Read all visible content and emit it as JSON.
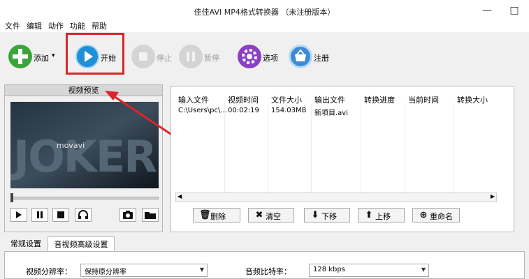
{
  "window": {
    "title": "佳佳AVI MP4格式转换器 （未注册版本）",
    "minimize": "—",
    "restore": "□",
    "close": "✕"
  },
  "menu": [
    "文件",
    "编辑",
    "动作",
    "功能",
    "帮助"
  ],
  "toolbar": {
    "add": "添加",
    "add_caret": "▾",
    "start": "开始",
    "stop": "停止",
    "pause": "暂停",
    "options": "选项",
    "register": "注册"
  },
  "preview": {
    "title": "视频预览",
    "movie_text": "JOKER",
    "watermark": "movavi",
    "seek_position": 0.0
  },
  "file_list": {
    "columns": [
      "输入文件",
      "视频时间",
      "文件大小",
      "输出文件",
      "转换进度",
      "当前时间",
      "转换大小"
    ],
    "rows": [
      {
        "input": "C:\\Users\\pc\\...",
        "duration": "00:02:19",
        "size": "154.03MB",
        "output": "新项目.avi",
        "progress": "",
        "current": "",
        "converted": ""
      }
    ]
  },
  "actions": {
    "delete": "删除",
    "clear": "清空",
    "down": "下移",
    "up": "上移",
    "rename": "重命名"
  },
  "settings": {
    "tabs": [
      "常规设置",
      "音视频高级设置"
    ],
    "active_tab": 1,
    "video_resolution_label": "视频分辨率：",
    "video_resolution_value": "保持原分辨率",
    "audio_bitrate_label": "音频比特率：",
    "audio_bitrate_value": "128 kbps"
  },
  "colors": {
    "highlight": "#d9262a",
    "add_green": "#3ba43b",
    "start_blue": "#1e90d6",
    "options_purple": "#8a3fc4",
    "register_blue": "#3c8ad8"
  }
}
